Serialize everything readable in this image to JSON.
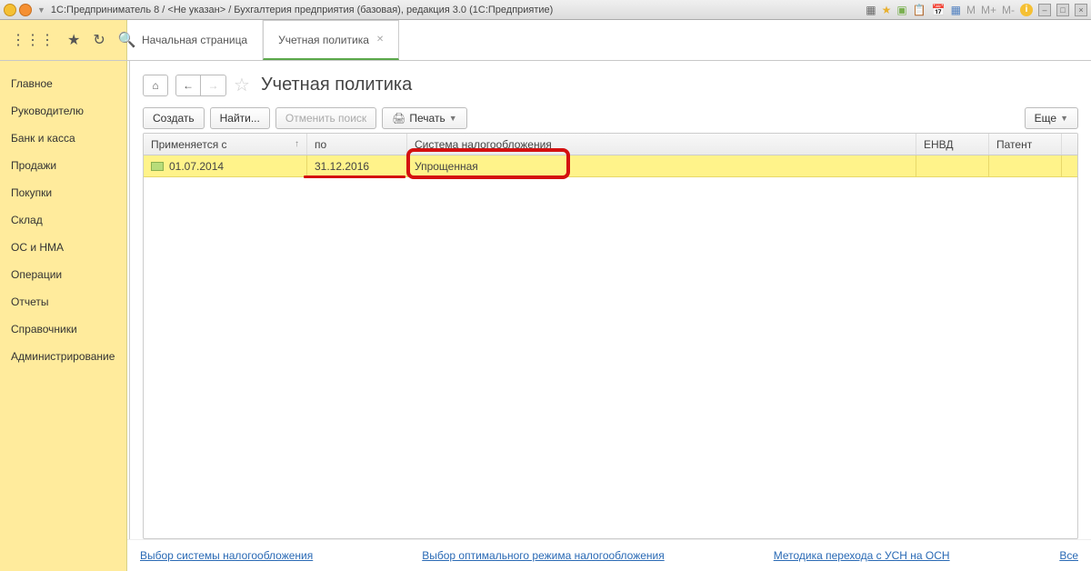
{
  "window_title": "1С:Предприниматель 8 / <Не указан> / Бухгалтерия предприятия (базовая), редакция 3.0  (1С:Предприятие)",
  "right_title_icons": [
    "M",
    "M+",
    "M-"
  ],
  "nav_tabs": {
    "home": "Начальная страница",
    "active": "Учетная политика"
  },
  "sidebar": {
    "items": [
      "Главное",
      "Руководителю",
      "Банк и касса",
      "Продажи",
      "Покупки",
      "Склад",
      "ОС и НМА",
      "Операции",
      "Отчеты",
      "Справочники",
      "Администрирование"
    ]
  },
  "page_title": "Учетная политика",
  "toolbar": {
    "create": "Создать",
    "find": "Найти...",
    "cancel_search": "Отменить поиск",
    "print": "Печать",
    "more": "Еще"
  },
  "table": {
    "headers": {
      "applies_from": "Применяется с",
      "to": "по",
      "tax_system": "Система налогообложения",
      "envd": "ЕНВД",
      "patent": "Патент"
    },
    "rows": [
      {
        "applies_from": "01.07.2014",
        "to": "31.12.2016",
        "tax_system": "Упрощенная",
        "envd": "",
        "patent": ""
      }
    ]
  },
  "footer": {
    "link1": "Выбор системы налогообложения",
    "link2": "Выбор оптимального режима налогообложения",
    "link3": "Методика перехода с УСН на ОСН",
    "link4": "Все"
  }
}
